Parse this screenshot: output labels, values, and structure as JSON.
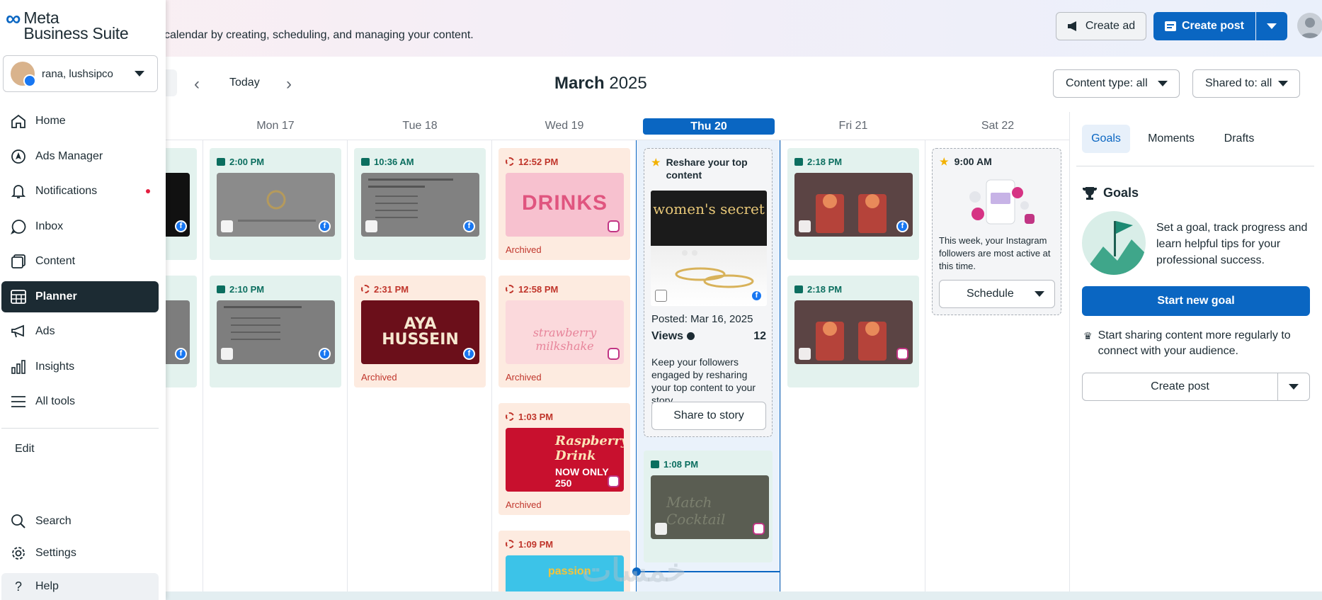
{
  "app": {
    "logo_mark": "∞",
    "logo_line1": "Meta",
    "logo_line2": "Business Suite",
    "account_name": "rana, lushsipco"
  },
  "header": {
    "subtitle": "calendar by creating, scheduling, and managing your content.",
    "create_ad": "Create ad",
    "create_post": "Create post"
  },
  "sidebar": {
    "items": [
      {
        "label": "Home",
        "icon": "home-icon"
      },
      {
        "label": "Ads Manager",
        "icon": "ads-manager-icon"
      },
      {
        "label": "Notifications",
        "icon": "bell-icon"
      },
      {
        "label": "Inbox",
        "icon": "chat-icon"
      },
      {
        "label": "Content",
        "icon": "content-icon"
      },
      {
        "label": "Planner",
        "icon": "planner-icon"
      },
      {
        "label": "Ads",
        "icon": "megaphone-icon"
      },
      {
        "label": "Insights",
        "icon": "bar-chart-icon"
      },
      {
        "label": "All tools",
        "icon": "menu-icon"
      }
    ],
    "edit": "Edit",
    "bottom": [
      {
        "label": "Search",
        "icon": "search-icon"
      },
      {
        "label": "Settings",
        "icon": "gear-icon"
      },
      {
        "label": "Help",
        "icon": "help-icon"
      }
    ]
  },
  "calendar": {
    "today": "Today",
    "month": "March",
    "year": "2025",
    "content_type": "Content type: all",
    "shared_to": "Shared to: all",
    "days": [
      "Mon 17",
      "Tue 18",
      "Wed 19",
      "Thu 20",
      "Fri 21",
      "Sat 22"
    ],
    "posts": {
      "mon": [
        "2:00 PM",
        "2:10 PM"
      ],
      "tue": [
        "10:36 AM",
        "2:31 PM"
      ],
      "wed": [
        "12:52 PM",
        "12:58 PM",
        "1:03 PM",
        "1:09 PM"
      ],
      "thu": [
        "1:08 PM"
      ],
      "fri": [
        "2:18 PM",
        "2:18 PM"
      ]
    },
    "archived": "Archived",
    "thumb_texts": {
      "drinks": "DRINKS",
      "drinks_sub": "drinks",
      "aya": "AYA\nHUSSEIN",
      "milkshake": "strawberry milkshake",
      "raspberry": "Raspberry Drink",
      "raspberry_price": "NOW ONLY 250",
      "passion": "passion",
      "mojito": "Match Cocktail",
      "womens": "women's secret"
    }
  },
  "insight": {
    "title": "Reshare your top content",
    "posted": "Posted: Mar 16, 2025",
    "views_label": "Views",
    "views_value": "12",
    "description": "Keep your followers engaged by resharing your top content to your story.",
    "share_button": "Share to story"
  },
  "suggestion": {
    "time": "9:00 AM",
    "text": "This week, your Instagram followers are most active at this time.",
    "schedule": "Schedule"
  },
  "right_panel": {
    "tabs": [
      "Goals",
      "Moments",
      "Drafts"
    ],
    "goals_title": "Goals",
    "goals_text": "Set a goal, track progress and learn helpful tips for your professional success.",
    "start_goal": "Start new goal",
    "share_more": "Start sharing content more regularly to connect with your audience.",
    "create_post": "Create post"
  },
  "colors": {
    "accent": "#0a66c2",
    "scheduled_green": "#e3f2ee",
    "published_peach": "#fdebe0"
  }
}
